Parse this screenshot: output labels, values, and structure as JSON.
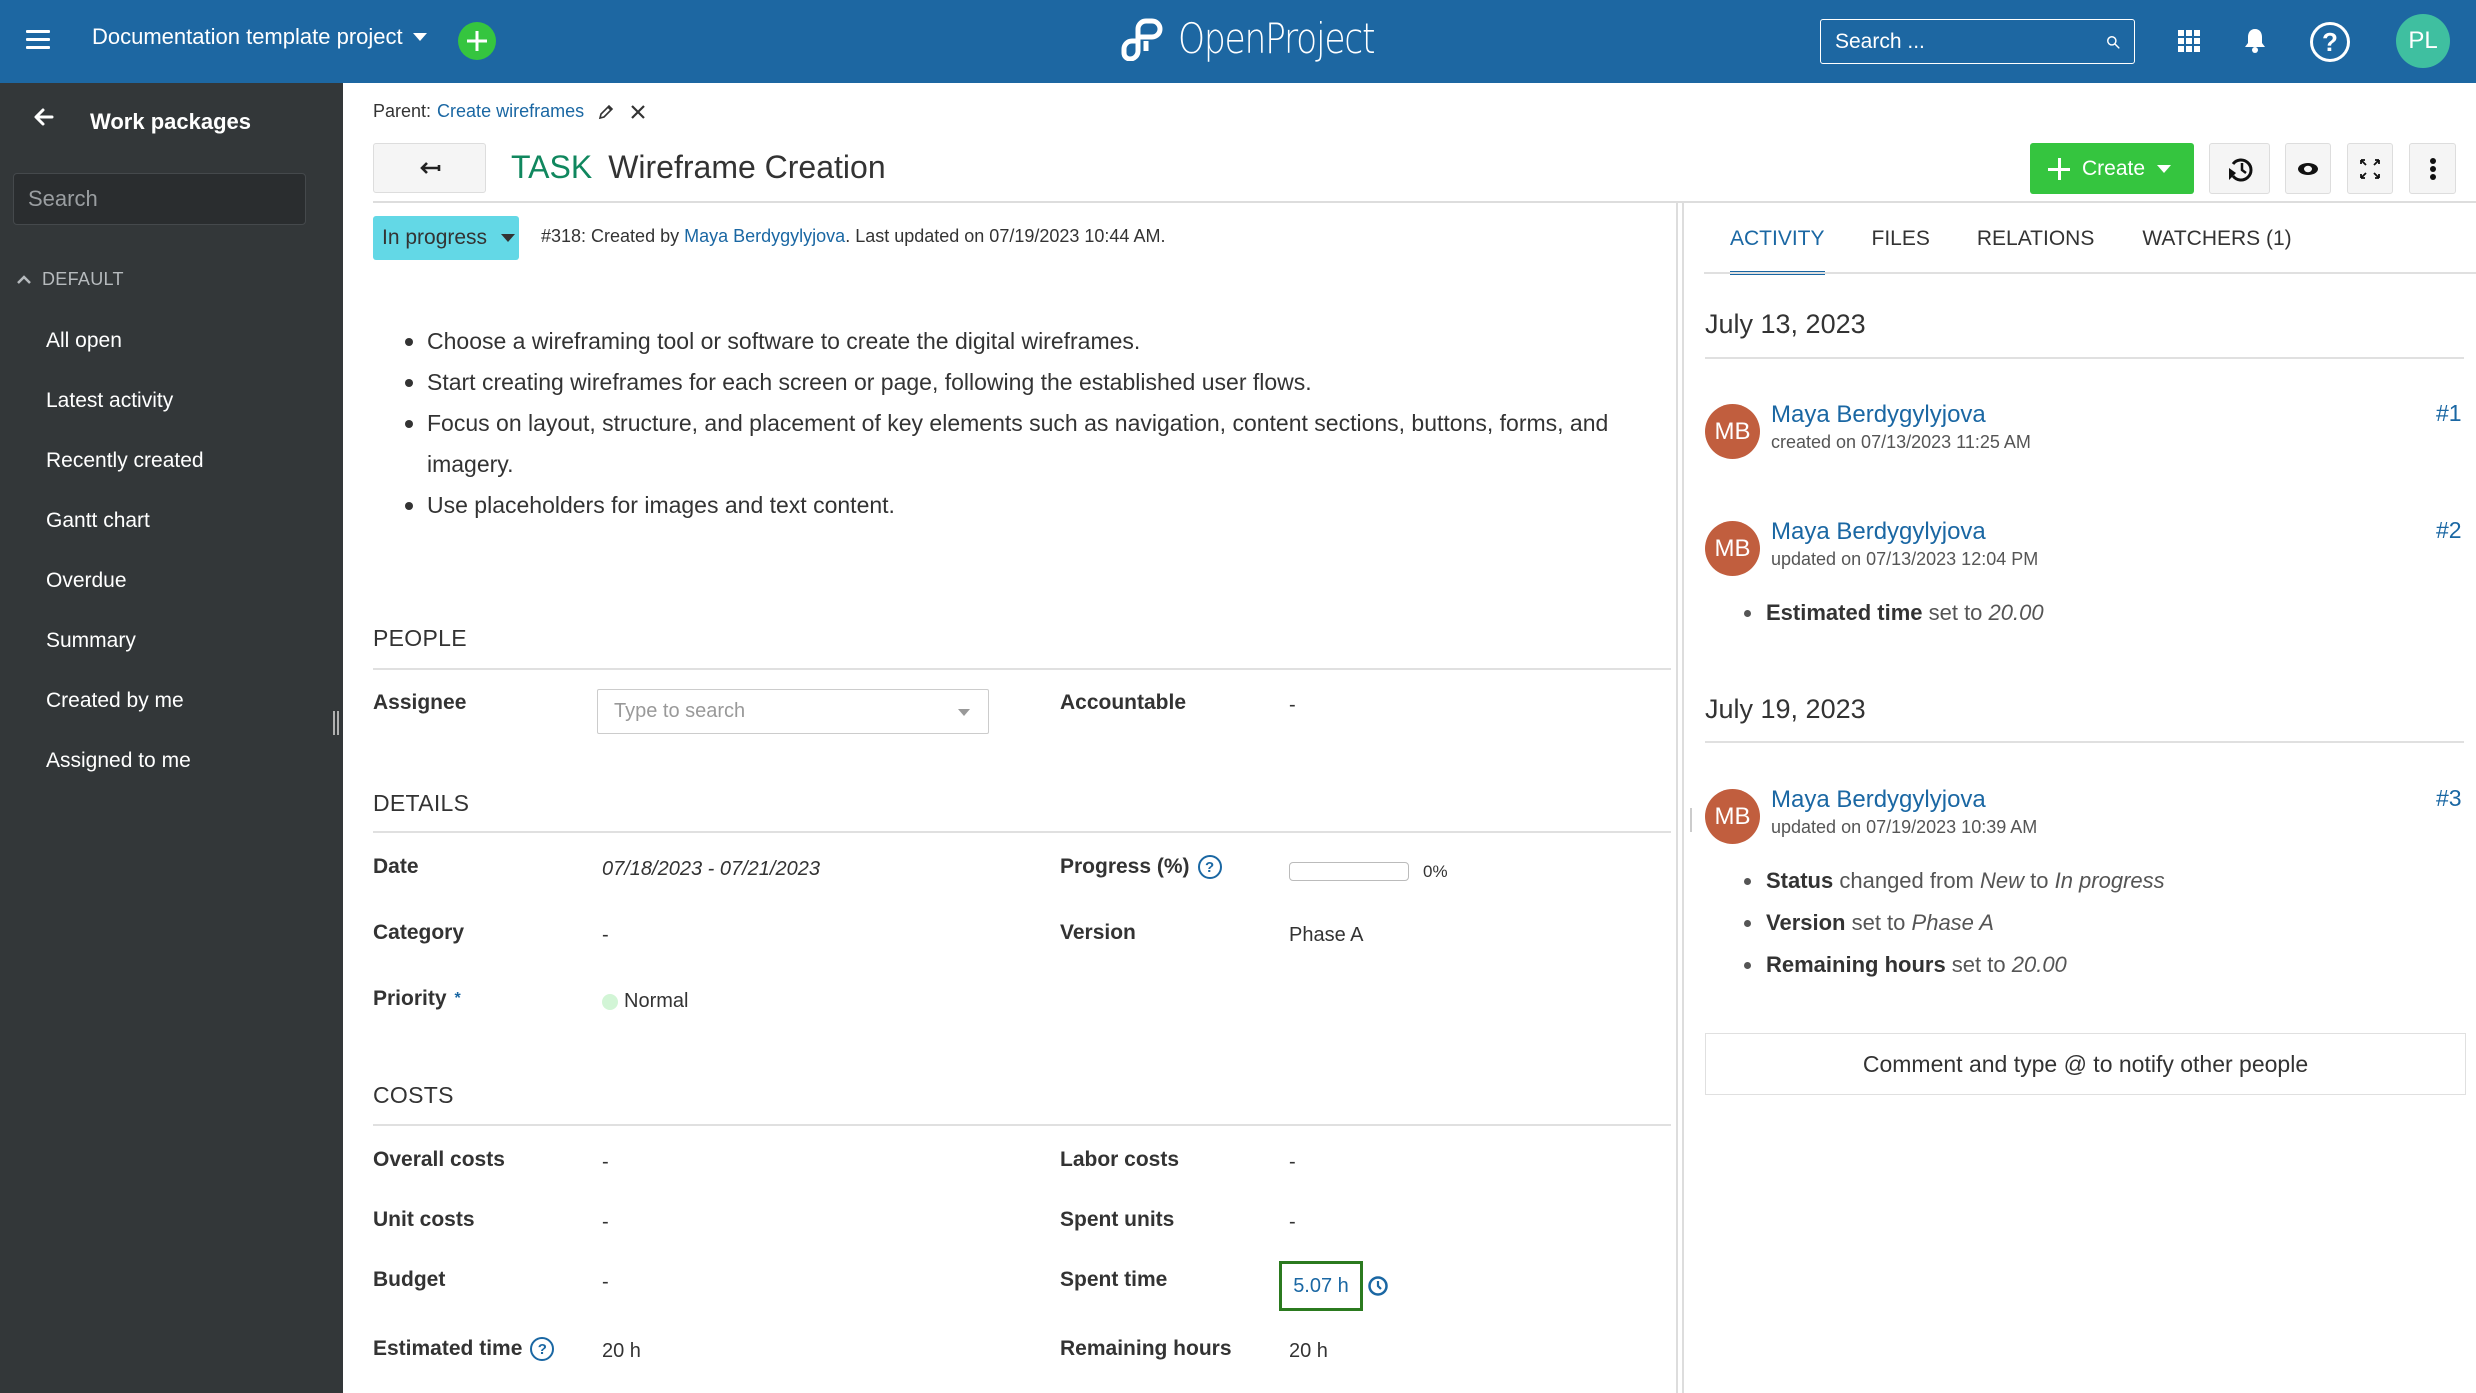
{
  "header": {
    "project_name": "Documentation template project",
    "logo_text": "OpenProject",
    "search_placeholder": "Search ...",
    "user_initials": "PL",
    "help_glyph": "?"
  },
  "sidebar": {
    "title": "Work packages",
    "search_placeholder": "Search",
    "group_label": "DEFAULT",
    "items": [
      {
        "label": "All open"
      },
      {
        "label": "Latest activity"
      },
      {
        "label": "Recently created"
      },
      {
        "label": "Gantt chart"
      },
      {
        "label": "Overdue"
      },
      {
        "label": "Summary"
      },
      {
        "label": "Created by me"
      },
      {
        "label": "Assigned to me"
      }
    ]
  },
  "work_package": {
    "parent_label": "Parent:",
    "parent_link": "Create wireframes",
    "type": "TASK",
    "subject": "Wireframe Creation",
    "status": "In progress",
    "meta_prefix": "#318: Created by ",
    "meta_author": "Maya Berdygylyjova",
    "meta_suffix": ". Last updated on 07/19/2023 10:44 AM.",
    "description": [
      "Choose a wireframing tool or software to create the digital wireframes.",
      "Start creating wireframes for each screen or page, following the established user flows.",
      "Focus on layout, structure, and placement of key elements such as navigation, content sections, buttons, forms, and imagery.",
      "Use placeholders for images and text content."
    ]
  },
  "toolbar": {
    "create_label": "Create"
  },
  "people": {
    "section_title": "PEOPLE",
    "assignee_label": "Assignee",
    "assignee_placeholder": "Type to search",
    "accountable_label": "Accountable",
    "accountable_value": "-"
  },
  "details": {
    "section_title": "DETAILS",
    "date_label": "Date",
    "date_value": "07/18/2023 - 07/21/2023",
    "progress_label": "Progress (%)",
    "progress_percent": 0,
    "progress_text": "0%",
    "category_label": "Category",
    "category_value": "-",
    "version_label": "Version",
    "version_value": "Phase A",
    "priority_label": "Priority",
    "priority_required": "*",
    "priority_value": "Normal",
    "priority_color": "#d2f5d6"
  },
  "costs": {
    "section_title": "COSTS",
    "overall_costs_label": "Overall costs",
    "overall_costs_value": "-",
    "labor_costs_label": "Labor costs",
    "labor_costs_value": "-",
    "unit_costs_label": "Unit costs",
    "unit_costs_value": "-",
    "spent_units_label": "Spent units",
    "spent_units_value": "-",
    "budget_label": "Budget",
    "budget_value": "-",
    "spent_time_label": "Spent time",
    "spent_time_value": "5.07 h",
    "estimated_time_label": "Estimated time",
    "estimated_time_value": "20 h",
    "remaining_hours_label": "Remaining hours",
    "remaining_hours_value": "20 h"
  },
  "activity": {
    "tabs": [
      {
        "label": "ACTIVITY",
        "active": true
      },
      {
        "label": "FILES",
        "active": false
      },
      {
        "label": "RELATIONS",
        "active": false
      },
      {
        "label": "WATCHERS (1)",
        "active": false
      }
    ],
    "days": [
      {
        "date": "July 13, 2023"
      },
      {
        "date": "July 19, 2023"
      }
    ],
    "entries": [
      {
        "initials": "MB",
        "user": "Maya Berdygylyjova",
        "meta": "created on 07/13/2023 11:25 AM",
        "number": "#1",
        "changes": []
      },
      {
        "initials": "MB",
        "user": "Maya Berdygylyjova",
        "meta": "updated on 07/13/2023 12:04 PM",
        "number": "#2",
        "changes": [
          {
            "field": "Estimated time",
            "text": " set to ",
            "value": "20.00"
          }
        ]
      },
      {
        "initials": "MB",
        "user": "Maya Berdygylyjova",
        "meta": "updated on 07/19/2023 10:39 AM",
        "number": "#3",
        "changes": [
          {
            "field": "Status",
            "text": " changed from ",
            "from": "New",
            "to_text": " to ",
            "value": "In progress"
          },
          {
            "field": "Version",
            "text": " set to ",
            "value": "Phase A"
          },
          {
            "field": "Remaining hours",
            "text": " set to ",
            "value": "20.00"
          }
        ]
      }
    ],
    "comment_placeholder": "Comment and type @ to notify other people"
  },
  "colors": {
    "header_bg": "#1d67a2",
    "sidebar_bg": "#333739",
    "accent_green": "#35c53f",
    "status_in_progress": "#63d8e6",
    "type_task": "#10875e",
    "link": "#1a67a3",
    "avatar_mb": "#c15e3e",
    "avatar_pl": "#3fbfa0"
  }
}
